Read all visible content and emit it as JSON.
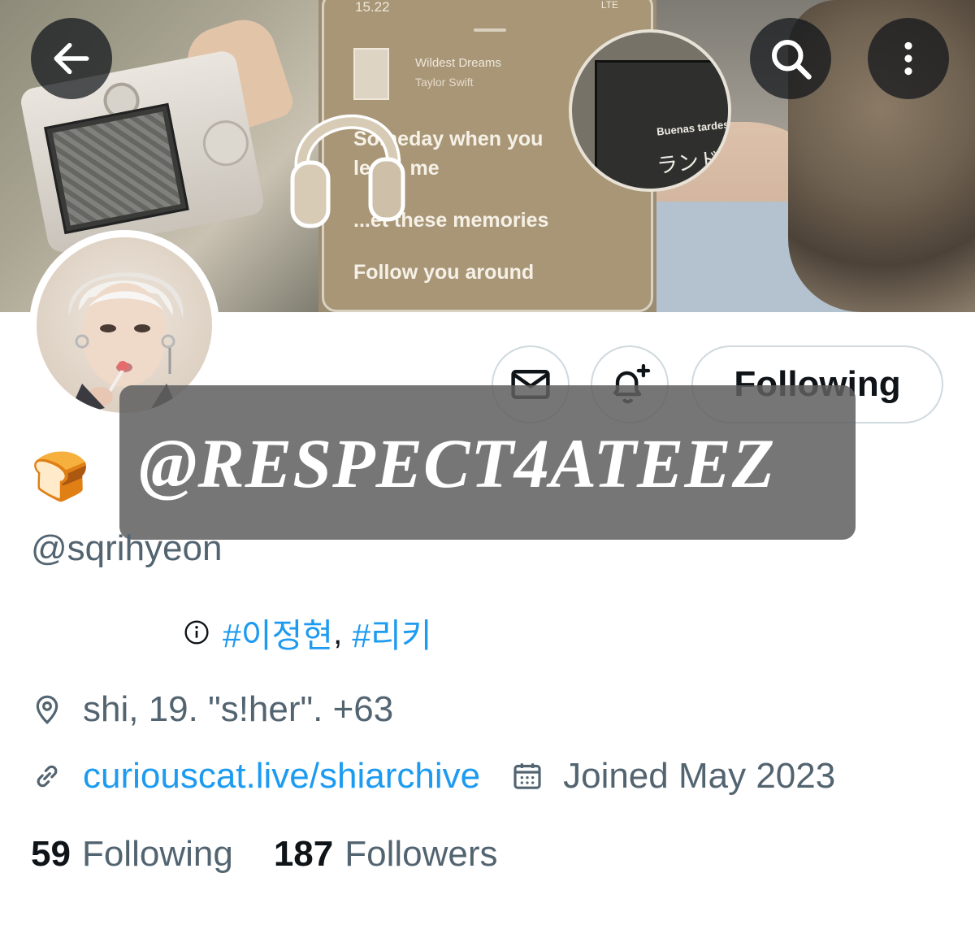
{
  "banner": {
    "phone_time": "15.22",
    "phone_status": "LTE",
    "song_title": "Wildest Dreams",
    "song_artist": "Taylor Swift",
    "lyrics": [
      "Someday when you",
      "leave me",
      "...et these memories",
      "Follow you around"
    ],
    "magnifier_text_1": "Buenas tardes",
    "magnifier_text_2": "ランド"
  },
  "nav": {
    "back_icon": "arrow-left-icon",
    "search_icon": "search-icon",
    "more_icon": "more-vertical-icon"
  },
  "actions": {
    "message_icon": "envelope-icon",
    "notify_icon": "bell-plus-icon",
    "following_label": "Following"
  },
  "watermark": {
    "text": "@RESPECT4ATEEZ"
  },
  "profile": {
    "display_name": "🍞",
    "handle": "@sqrihyeon",
    "bio": {
      "hashtag_1": "#이정현",
      "separator": ",",
      "hashtag_2": "#리키"
    },
    "location": "shi, 19. \"s!her\". +63",
    "url": "curiouscat.live/shiarchive",
    "joined": "Joined May 2023",
    "following_count": "59",
    "following_label": "Following",
    "followers_count": "187",
    "followers_label": "Followers"
  },
  "colors": {
    "link": "#1d9bf0",
    "secondary_text": "#536471",
    "primary_text": "#0f1419",
    "border": "#cfd9de"
  }
}
